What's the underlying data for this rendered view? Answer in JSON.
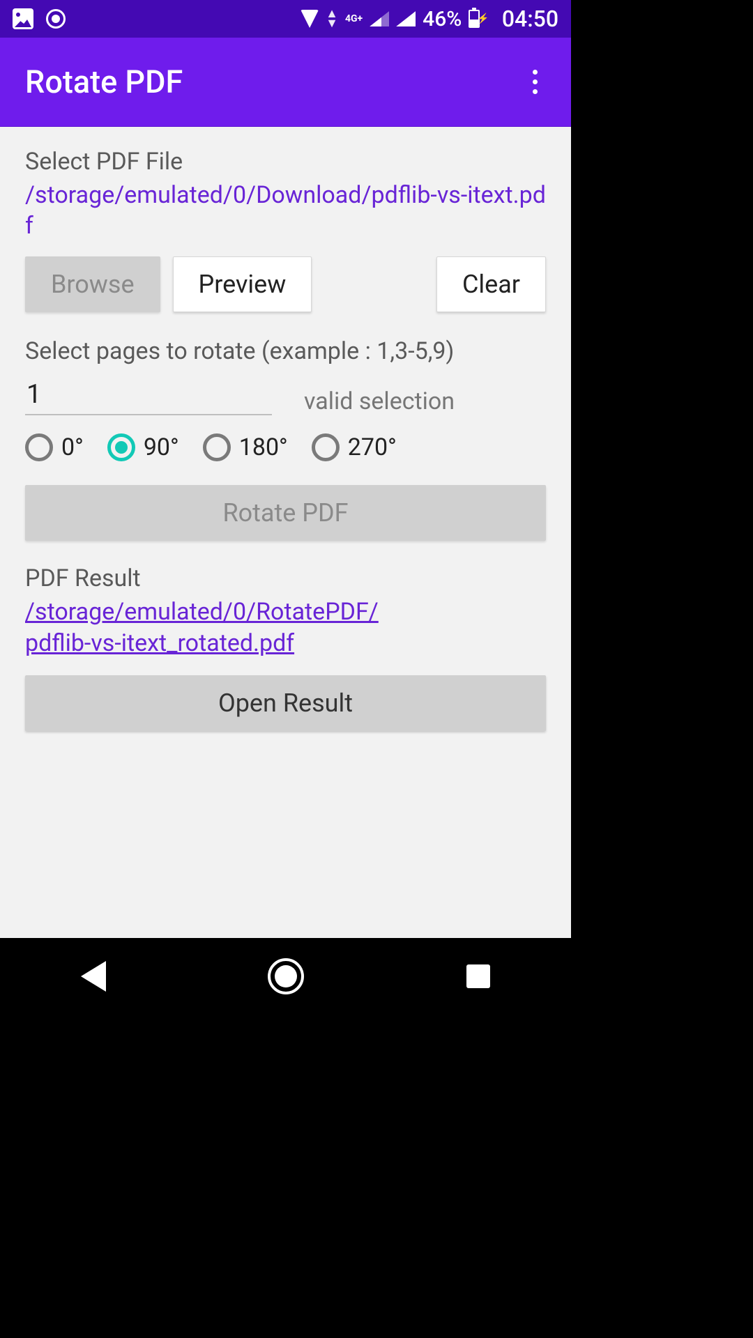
{
  "status": {
    "network_label": "4G+",
    "battery": "46%",
    "time": "04:50"
  },
  "appbar": {
    "title": "Rotate PDF"
  },
  "select": {
    "label": "Select PDF File",
    "path": "/storage/emulated/0/Download/pdflib-vs-itext.pdf",
    "browse": "Browse",
    "preview": "Preview",
    "clear": "Clear"
  },
  "pages": {
    "label": "Select pages to rotate (example : 1,3-5,9)",
    "value": "1",
    "status": "valid selection"
  },
  "angles": {
    "options": [
      "0°",
      "90°",
      "180°",
      "270°"
    ],
    "selected_index": 1
  },
  "rotate": {
    "label": "Rotate PDF"
  },
  "result": {
    "label": "PDF Result",
    "path_line1": "/storage/emulated/0/RotatePDF/",
    "path_line2": "pdflib-vs-itext_rotated.pdf",
    "open": "Open Result"
  }
}
